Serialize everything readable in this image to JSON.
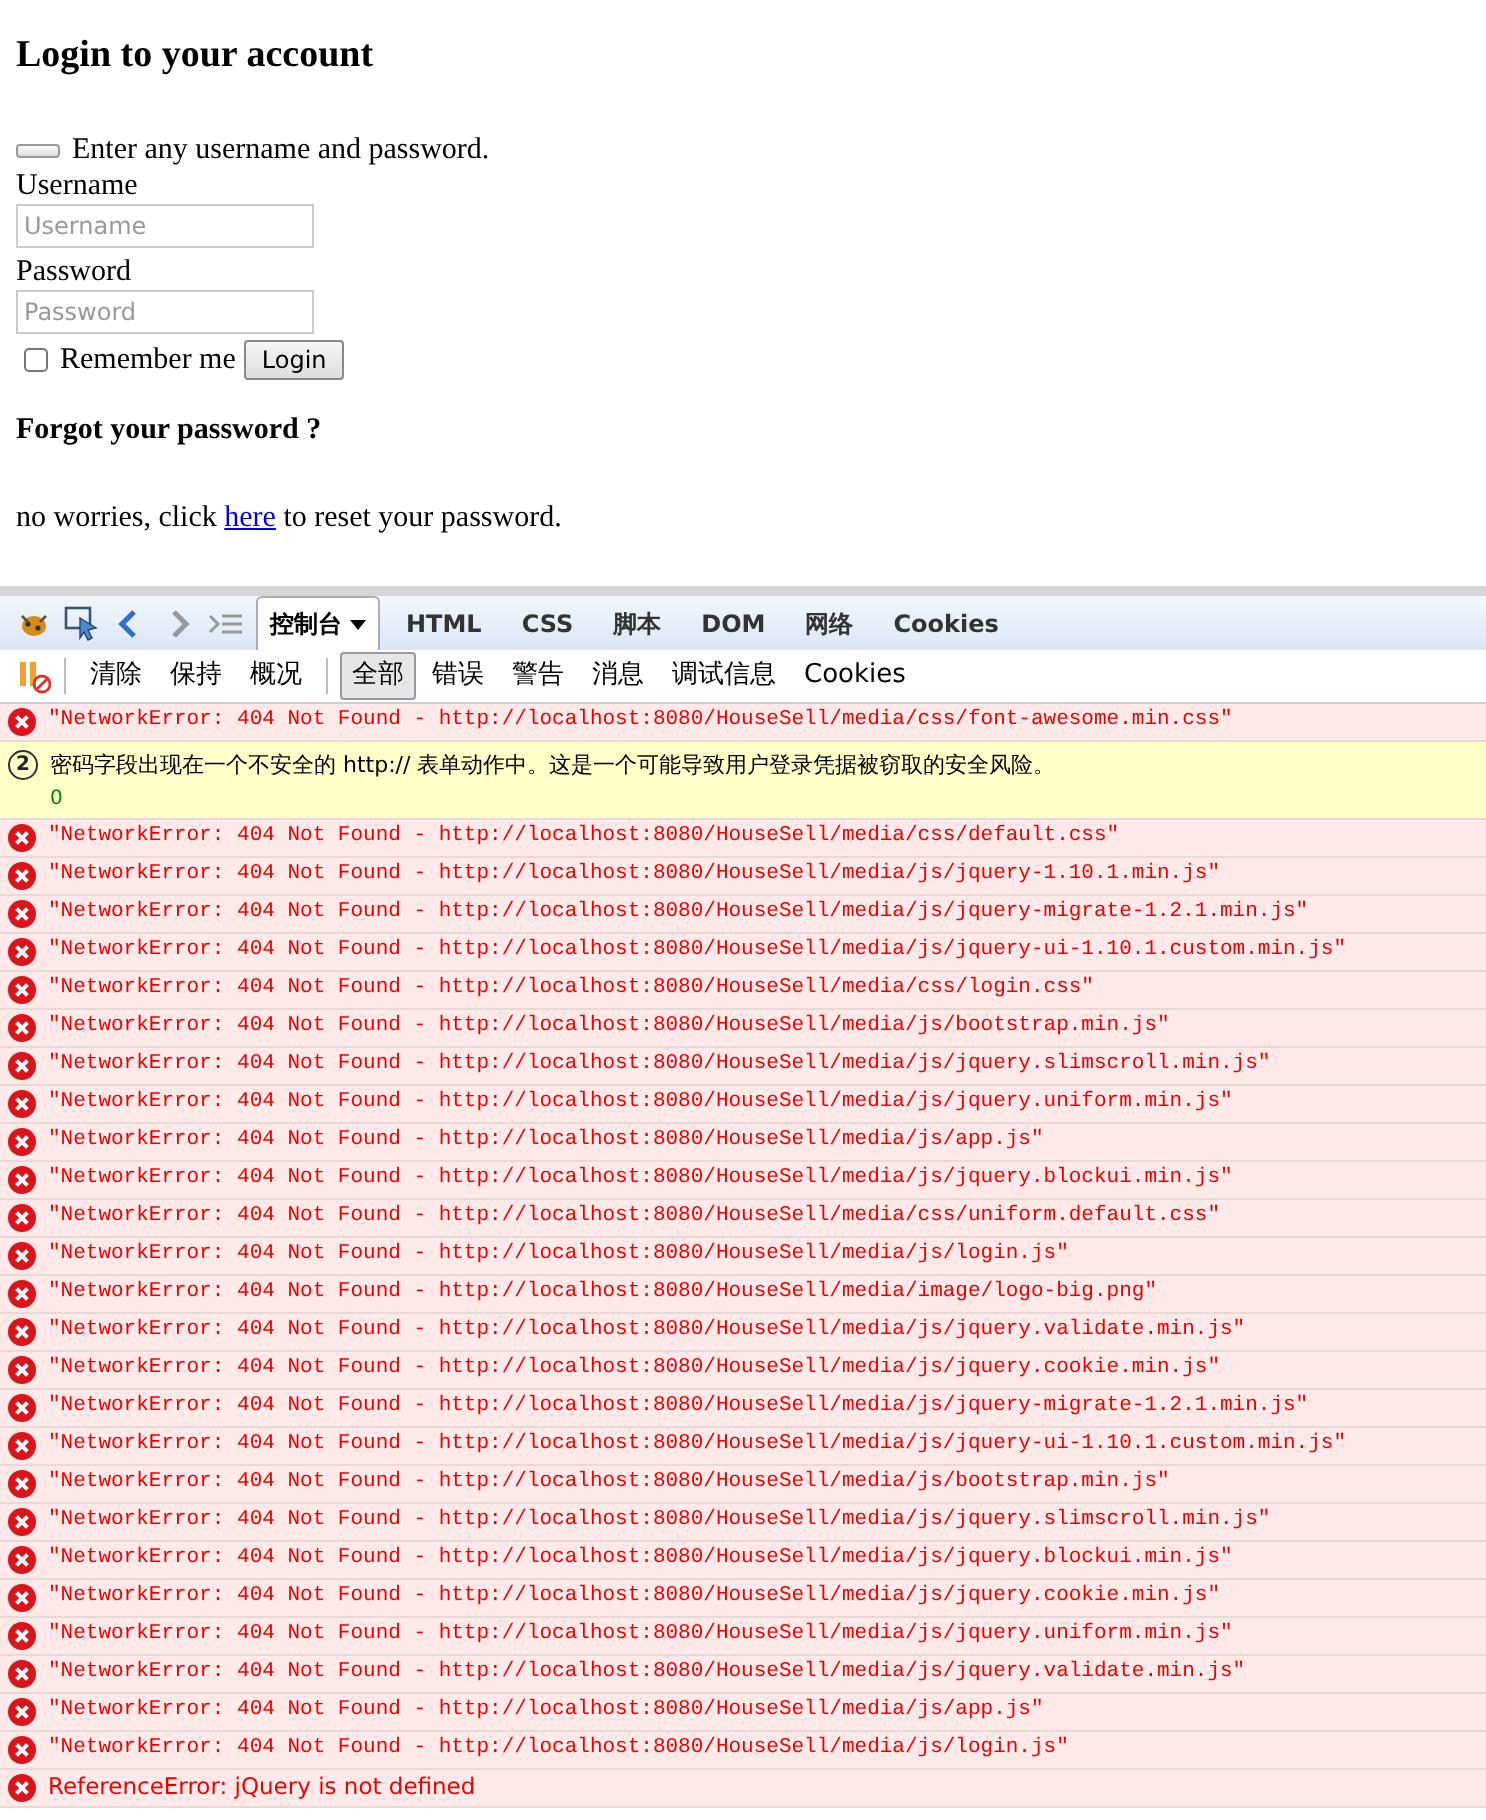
{
  "page": {
    "heading": "Login to your account",
    "alert_text": "Enter any username and password.",
    "fields": [
      {
        "label": "Username",
        "placeholder": "Username"
      },
      {
        "label": "Password",
        "placeholder": "Password"
      }
    ],
    "remember": {
      "label": "Remember me",
      "checked": false
    },
    "login_button": "Login",
    "forgot_heading": "Forgot your password ?",
    "forgot_before": "no worries, click ",
    "forgot_link": "here",
    "forgot_after": " to reset your password."
  },
  "devtools": {
    "tabs": [
      {
        "label": "控制台",
        "selected": true,
        "dropdown": true
      },
      {
        "label": "HTML",
        "selected": false,
        "dropdown": false
      },
      {
        "label": "CSS",
        "selected": false,
        "dropdown": false
      },
      {
        "label": "脚本",
        "selected": false,
        "dropdown": false
      },
      {
        "label": "DOM",
        "selected": false,
        "dropdown": false
      },
      {
        "label": "网络",
        "selected": false,
        "dropdown": false
      },
      {
        "label": "Cookies",
        "selected": false,
        "dropdown": false
      }
    ],
    "actions": [
      "清除",
      "保持",
      "概况"
    ],
    "filters": [
      {
        "label": "全部",
        "selected": true
      },
      {
        "label": "错误",
        "selected": false
      },
      {
        "label": "警告",
        "selected": false
      },
      {
        "label": "消息",
        "selected": false
      },
      {
        "label": "调试信息",
        "selected": false
      },
      {
        "label": "Cookies",
        "selected": false
      }
    ],
    "log": [
      {
        "kind": "network",
        "text": "\"NetworkError: 404 Not Found - http://localhost:8080/HouseSell/media/css/font-awesome.min.css\""
      },
      {
        "kind": "warning",
        "count": "2",
        "text": "密码字段出现在一个不安全的 http:// 表单动作中。这是一个可能导致用户登录凭据被窃取的安全风险。",
        "detail": "0"
      },
      {
        "kind": "network",
        "text": "\"NetworkError: 404 Not Found - http://localhost:8080/HouseSell/media/css/default.css\""
      },
      {
        "kind": "network",
        "text": "\"NetworkError: 404 Not Found - http://localhost:8080/HouseSell/media/js/jquery-1.10.1.min.js\""
      },
      {
        "kind": "network",
        "text": "\"NetworkError: 404 Not Found - http://localhost:8080/HouseSell/media/js/jquery-migrate-1.2.1.min.js\""
      },
      {
        "kind": "network",
        "text": "\"NetworkError: 404 Not Found - http://localhost:8080/HouseSell/media/js/jquery-ui-1.10.1.custom.min.js\""
      },
      {
        "kind": "network",
        "text": "\"NetworkError: 404 Not Found - http://localhost:8080/HouseSell/media/css/login.css\""
      },
      {
        "kind": "network",
        "text": "\"NetworkError: 404 Not Found - http://localhost:8080/HouseSell/media/js/bootstrap.min.js\""
      },
      {
        "kind": "network",
        "text": "\"NetworkError: 404 Not Found - http://localhost:8080/HouseSell/media/js/jquery.slimscroll.min.js\""
      },
      {
        "kind": "network",
        "text": "\"NetworkError: 404 Not Found - http://localhost:8080/HouseSell/media/js/jquery.uniform.min.js\""
      },
      {
        "kind": "network",
        "text": "\"NetworkError: 404 Not Found - http://localhost:8080/HouseSell/media/js/app.js\""
      },
      {
        "kind": "network",
        "text": "\"NetworkError: 404 Not Found - http://localhost:8080/HouseSell/media/js/jquery.blockui.min.js\""
      },
      {
        "kind": "network",
        "text": "\"NetworkError: 404 Not Found - http://localhost:8080/HouseSell/media/css/uniform.default.css\""
      },
      {
        "kind": "network",
        "text": "\"NetworkError: 404 Not Found - http://localhost:8080/HouseSell/media/js/login.js\""
      },
      {
        "kind": "network",
        "text": "\"NetworkError: 404 Not Found - http://localhost:8080/HouseSell/media/image/logo-big.png\""
      },
      {
        "kind": "network",
        "text": "\"NetworkError: 404 Not Found - http://localhost:8080/HouseSell/media/js/jquery.validate.min.js\""
      },
      {
        "kind": "network",
        "text": "\"NetworkError: 404 Not Found - http://localhost:8080/HouseSell/media/js/jquery.cookie.min.js\""
      },
      {
        "kind": "network",
        "text": "\"NetworkError: 404 Not Found - http://localhost:8080/HouseSell/media/js/jquery-migrate-1.2.1.min.js\""
      },
      {
        "kind": "network",
        "text": "\"NetworkError: 404 Not Found - http://localhost:8080/HouseSell/media/js/jquery-ui-1.10.1.custom.min.js\""
      },
      {
        "kind": "network",
        "text": "\"NetworkError: 404 Not Found - http://localhost:8080/HouseSell/media/js/bootstrap.min.js\""
      },
      {
        "kind": "network",
        "text": "\"NetworkError: 404 Not Found - http://localhost:8080/HouseSell/media/js/jquery.slimscroll.min.js\""
      },
      {
        "kind": "network",
        "text": "\"NetworkError: 404 Not Found - http://localhost:8080/HouseSell/media/js/jquery.blockui.min.js\""
      },
      {
        "kind": "network",
        "text": "\"NetworkError: 404 Not Found - http://localhost:8080/HouseSell/media/js/jquery.cookie.min.js\""
      },
      {
        "kind": "network",
        "text": "\"NetworkError: 404 Not Found - http://localhost:8080/HouseSell/media/js/jquery.uniform.min.js\""
      },
      {
        "kind": "network",
        "text": "\"NetworkError: 404 Not Found - http://localhost:8080/HouseSell/media/js/jquery.validate.min.js\""
      },
      {
        "kind": "network",
        "text": "\"NetworkError: 404 Not Found - http://localhost:8080/HouseSell/media/js/app.js\""
      },
      {
        "kind": "network",
        "text": "\"NetworkError: 404 Not Found - http://localhost:8080/HouseSell/media/js/login.js\""
      },
      {
        "kind": "script",
        "text": "ReferenceError: jQuery is not defined"
      }
    ]
  }
}
